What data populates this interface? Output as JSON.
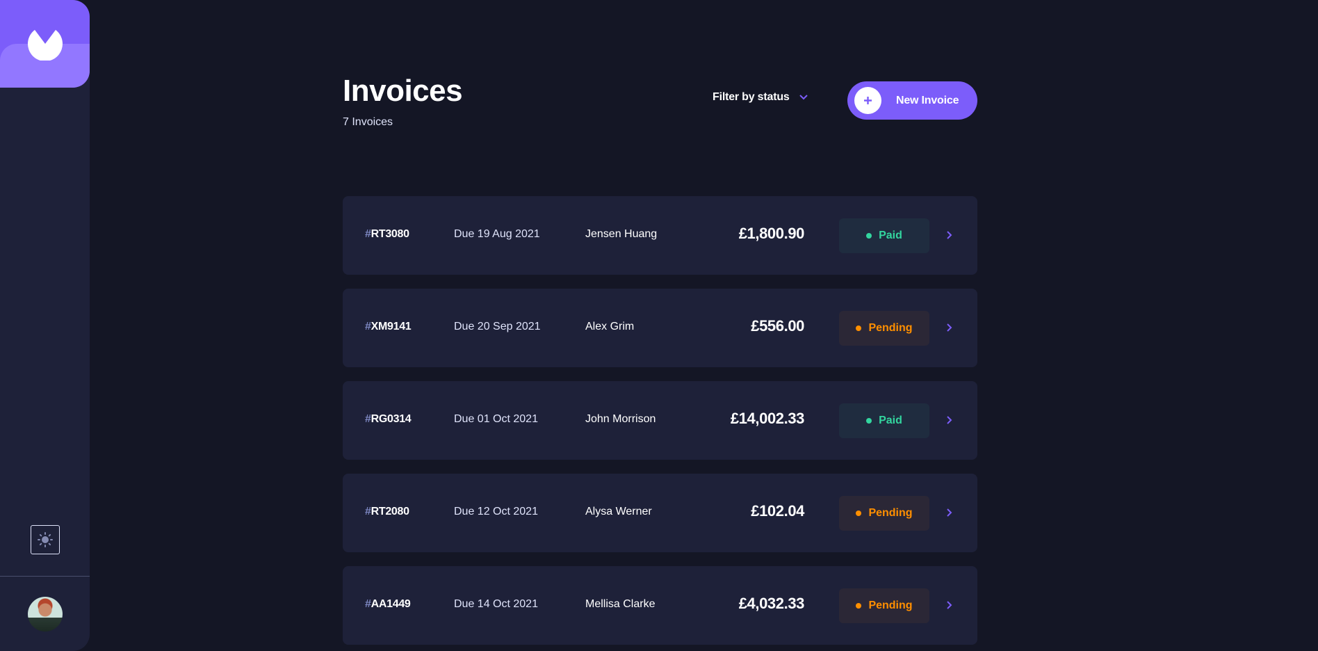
{
  "header": {
    "title": "Invoices",
    "subtitle": "7 Invoices",
    "filter_label": "Filter by status",
    "new_invoice_label": "New Invoice"
  },
  "invoices": [
    {
      "hash": "#",
      "id": "RT3080",
      "due": "Due 19 Aug 2021",
      "client": "Jensen Huang",
      "amount": "£1,800.90",
      "status": "Paid"
    },
    {
      "hash": "#",
      "id": "XM9141",
      "due": "Due 20 Sep 2021",
      "client": "Alex Grim",
      "amount": "£556.00",
      "status": "Pending"
    },
    {
      "hash": "#",
      "id": "RG0314",
      "due": "Due 01 Oct 2021",
      "client": "John Morrison",
      "amount": "£14,002.33",
      "status": "Paid"
    },
    {
      "hash": "#",
      "id": "RT2080",
      "due": "Due 12 Oct 2021",
      "client": "Alysa Werner",
      "amount": "£102.04",
      "status": "Pending"
    },
    {
      "hash": "#",
      "id": "AA1449",
      "due": "Due 14 Oct 2021",
      "client": "Mellisa Clarke",
      "amount": "£4,032.33",
      "status": "Pending"
    }
  ],
  "colors": {
    "accent": "#7c5dfa",
    "background": "#141625",
    "card": "#1e2139",
    "paid": "#33d69f",
    "pending": "#ff8f00"
  },
  "icons": {
    "logo": "logo-icon",
    "theme": "sun-icon",
    "filter": "chevron-down-icon",
    "new": "plus-icon",
    "row": "chevron-right-icon"
  }
}
